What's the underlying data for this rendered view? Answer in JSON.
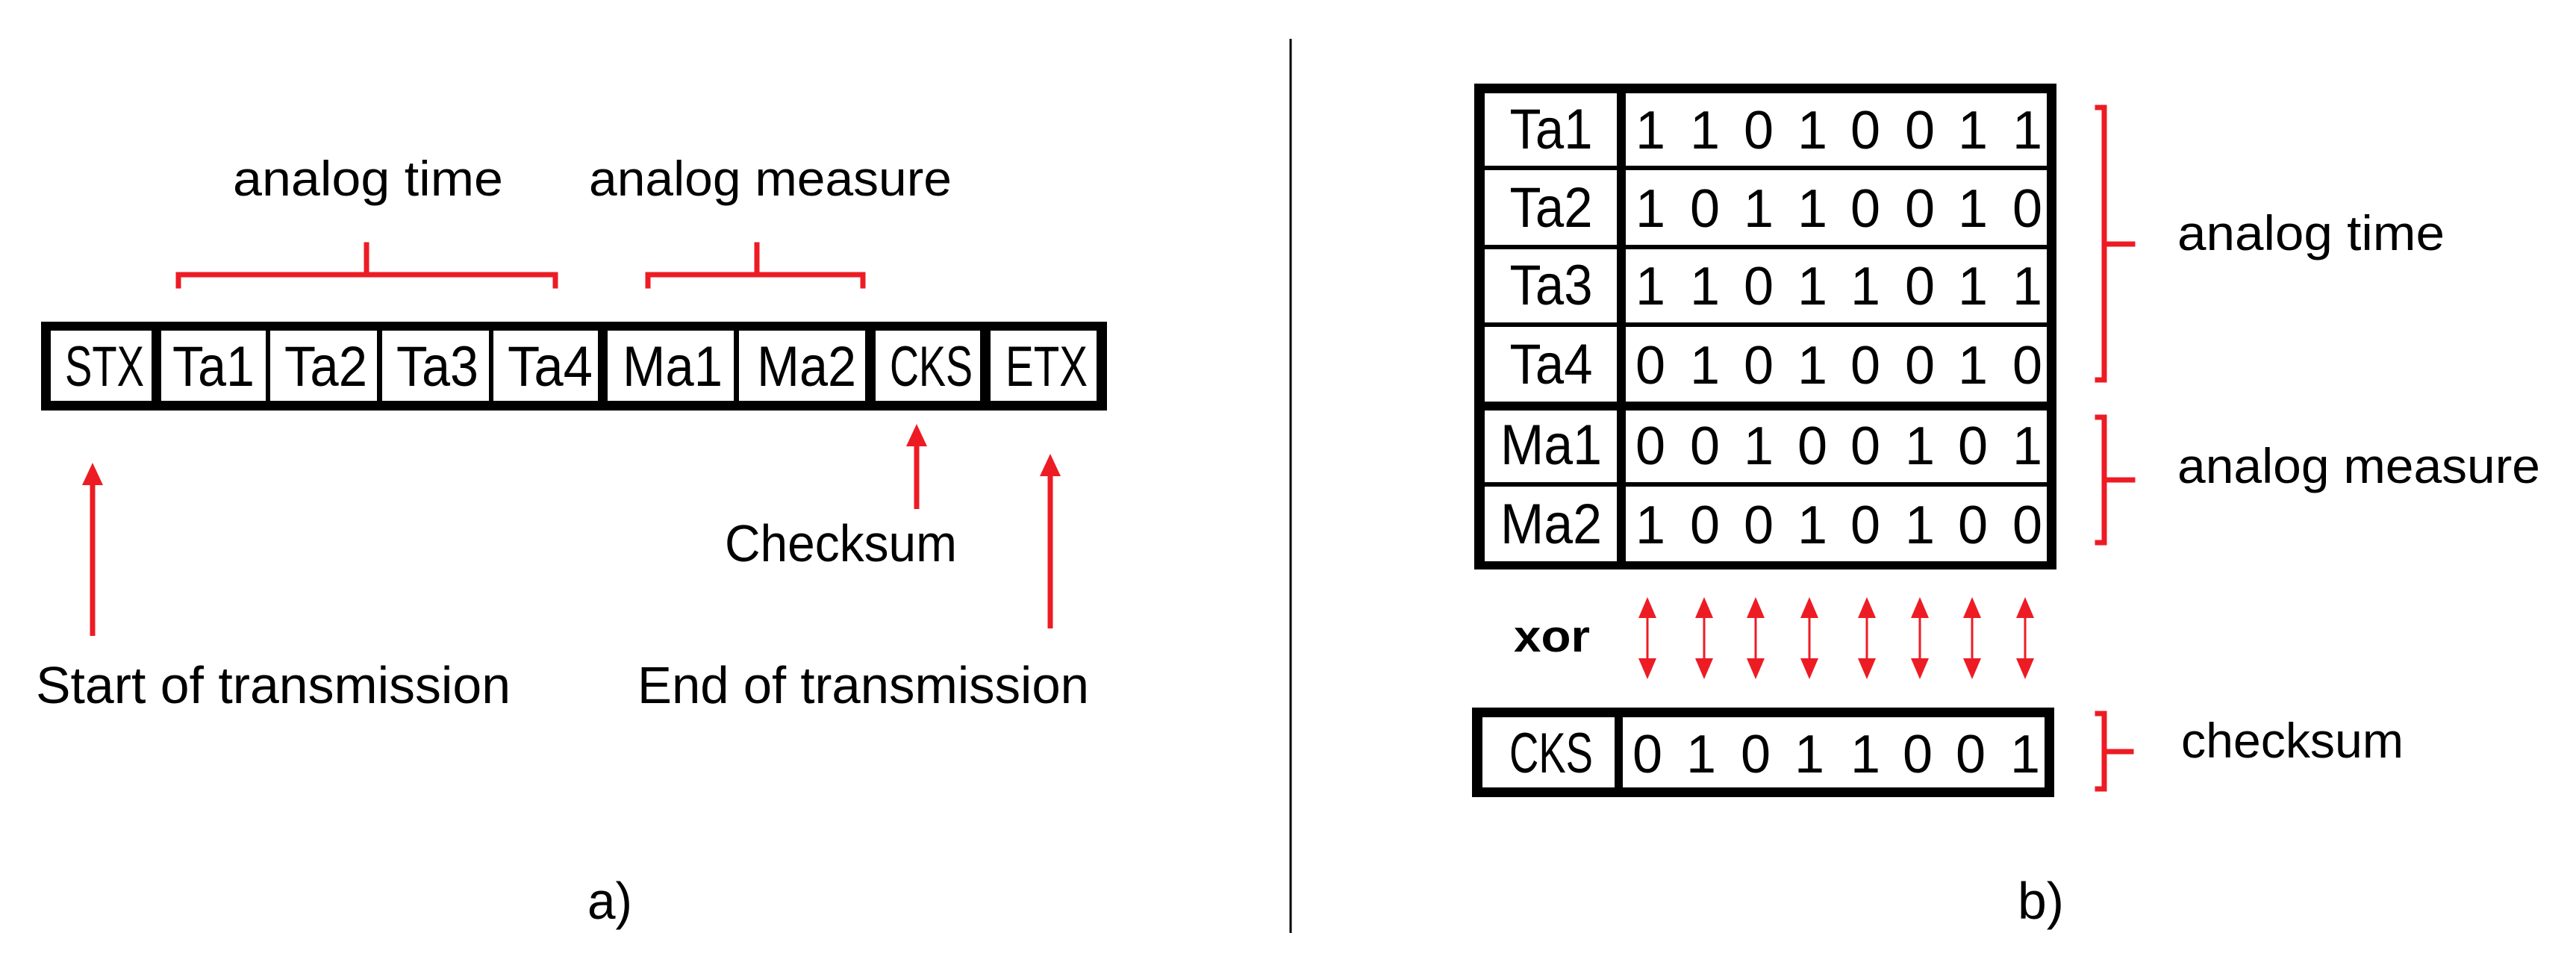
{
  "colors": {
    "annotation": "#ED1C24",
    "frame": "#000000",
    "background": "#FFFFFF"
  },
  "panel_a": {
    "caption": "a)",
    "group_labels": {
      "analog_time": "analog time",
      "analog_measure": "analog measure"
    },
    "frame_fields": [
      {
        "label": "STX"
      },
      {
        "label": "Ta1"
      },
      {
        "label": "Ta2"
      },
      {
        "label": "Ta3"
      },
      {
        "label": "Ta4"
      },
      {
        "label": "Ma1"
      },
      {
        "label": "Ma2"
      },
      {
        "label": "CKS"
      },
      {
        "label": "ETX"
      }
    ],
    "annotations": {
      "start": "Start of transmission",
      "checksum": "Checksum",
      "end": "End of transmission"
    }
  },
  "panel_b": {
    "caption": "b)",
    "operation": "xor",
    "rows": [
      {
        "label": "Ta1",
        "bits": [
          "1",
          "1",
          "0",
          "1",
          "0",
          "0",
          "1",
          "1"
        ]
      },
      {
        "label": "Ta2",
        "bits": [
          "1",
          "0",
          "1",
          "1",
          "0",
          "0",
          "1",
          "0"
        ]
      },
      {
        "label": "Ta3",
        "bits": [
          "1",
          "1",
          "0",
          "1",
          "1",
          "0",
          "1",
          "1"
        ]
      },
      {
        "label": "Ta4",
        "bits": [
          "0",
          "1",
          "0",
          "1",
          "0",
          "0",
          "1",
          "0"
        ]
      },
      {
        "label": "Ma1",
        "bits": [
          "0",
          "0",
          "1",
          "0",
          "0",
          "1",
          "0",
          "1"
        ]
      },
      {
        "label": "Ma2",
        "bits": [
          "1",
          "0",
          "0",
          "1",
          "0",
          "1",
          "0",
          "0"
        ]
      }
    ],
    "checksum_row": {
      "label": "CKS",
      "bits": [
        "0",
        "1",
        "0",
        "1",
        "1",
        "0",
        "0",
        "1"
      ]
    },
    "group_labels": {
      "analog_time": "analog time",
      "analog_measure": "analog measure",
      "checksum": "checksum"
    }
  }
}
